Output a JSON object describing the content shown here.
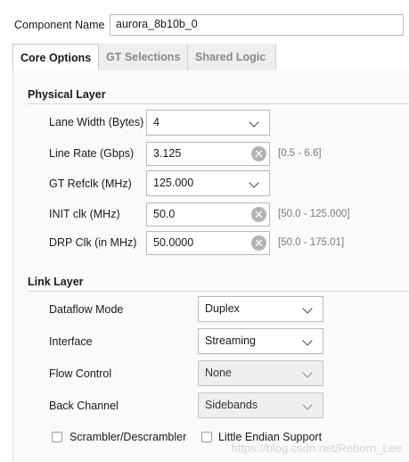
{
  "component": {
    "label": "Component Name",
    "value": "aurora_8b10b_0"
  },
  "tabs": [
    {
      "label": "Core Options"
    },
    {
      "label": "GT Selections"
    },
    {
      "label": "Shared Logic"
    }
  ],
  "physical_layer": {
    "title": "Physical Layer",
    "lane_width": {
      "label": "Lane Width (Bytes)",
      "value": "4"
    },
    "line_rate": {
      "label": "Line Rate (Gbps)",
      "value": "3.125",
      "range": "[0.5 - 6.6]"
    },
    "gt_refclk": {
      "label": "GT Refclk (MHz)",
      "value": "125.000"
    },
    "init_clk": {
      "label": "INIT clk (MHz)",
      "value": "50.0",
      "range": "[50.0 - 125.000]"
    },
    "drp_clk": {
      "label": "DRP Clk (in MHz)",
      "value": "50.0000",
      "range": "[50.0 - 175.01]"
    }
  },
  "link_layer": {
    "title": "Link Layer",
    "dataflow_mode": {
      "label": "Dataflow Mode",
      "value": "Duplex"
    },
    "interface": {
      "label": "Interface",
      "value": "Streaming"
    },
    "flow_control": {
      "label": "Flow Control",
      "value": "None"
    },
    "back_channel": {
      "label": "Back Channel",
      "value": "Sidebands"
    },
    "scrambler": {
      "label": "Scrambler/Descrambler",
      "checked": false
    },
    "little_endian": {
      "label": "Little Endian Support",
      "checked": false
    }
  },
  "watermark": "https://blog.csdn.net/Reborn_Lee",
  "icons": {
    "clear": "clear-icon",
    "dropdown": "chevron-down-icon"
  }
}
